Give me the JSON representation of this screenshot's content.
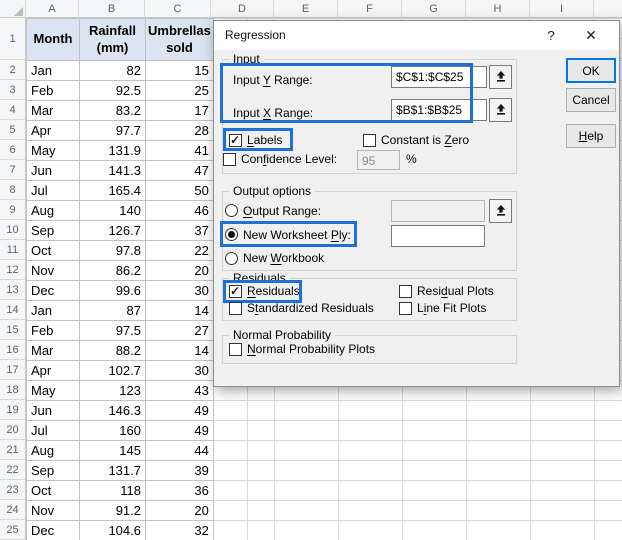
{
  "colors": {
    "annotation_blue": "#1e6fd8",
    "ok_focus_border": "#0078d7",
    "table_header_fill": "#dce3f1"
  },
  "sheet": {
    "col_headers": [
      "A",
      "B",
      "C",
      "D",
      "E",
      "F",
      "G",
      "H",
      "I"
    ],
    "header_row_num": "1",
    "table": {
      "headers": {
        "month": "Month",
        "rainfall": "Rainfall (mm)",
        "umbrellas": "Umbrellas sold"
      },
      "rows": [
        {
          "num": "2",
          "month": "Jan",
          "rain": "82",
          "sold": "15"
        },
        {
          "num": "3",
          "month": "Feb",
          "rain": "92.5",
          "sold": "25"
        },
        {
          "num": "4",
          "month": "Mar",
          "rain": "83.2",
          "sold": "17"
        },
        {
          "num": "5",
          "month": "Apr",
          "rain": "97.7",
          "sold": "28"
        },
        {
          "num": "6",
          "month": "May",
          "rain": "131.9",
          "sold": "41"
        },
        {
          "num": "7",
          "month": "Jun",
          "rain": "141.3",
          "sold": "47"
        },
        {
          "num": "8",
          "month": "Jul",
          "rain": "165.4",
          "sold": "50"
        },
        {
          "num": "9",
          "month": "Aug",
          "rain": "140",
          "sold": "46"
        },
        {
          "num": "10",
          "month": "Sep",
          "rain": "126.7",
          "sold": "37"
        },
        {
          "num": "11",
          "month": "Oct",
          "rain": "97.8",
          "sold": "22"
        },
        {
          "num": "12",
          "month": "Nov",
          "rain": "86.2",
          "sold": "20"
        },
        {
          "num": "13",
          "month": "Dec",
          "rain": "99.6",
          "sold": "30"
        },
        {
          "num": "14",
          "month": "Jan",
          "rain": "87",
          "sold": "14"
        },
        {
          "num": "15",
          "month": "Feb",
          "rain": "97.5",
          "sold": "27"
        },
        {
          "num": "16",
          "month": "Mar",
          "rain": "88.2",
          "sold": "14"
        },
        {
          "num": "17",
          "month": "Apr",
          "rain": "102.7",
          "sold": "30"
        },
        {
          "num": "18",
          "month": "May",
          "rain": "123",
          "sold": "43"
        },
        {
          "num": "19",
          "month": "Jun",
          "rain": "146.3",
          "sold": "49"
        },
        {
          "num": "20",
          "month": "Jul",
          "rain": "160",
          "sold": "49"
        },
        {
          "num": "21",
          "month": "Aug",
          "rain": "145",
          "sold": "44"
        },
        {
          "num": "22",
          "month": "Sep",
          "rain": "131.7",
          "sold": "39"
        },
        {
          "num": "23",
          "month": "Oct",
          "rain": "118",
          "sold": "36"
        },
        {
          "num": "24",
          "month": "Nov",
          "rain": "91.2",
          "sold": "20"
        },
        {
          "num": "25",
          "month": "Dec",
          "rain": "104.6",
          "sold": "32"
        }
      ]
    }
  },
  "dialog": {
    "title": "Regression",
    "titlebar": {
      "help_icon": "?",
      "close_icon": "✕"
    },
    "buttons": {
      "ok": "OK",
      "cancel": "Cancel",
      "help": {
        "pre": "",
        "key": "H",
        "post": "elp"
      }
    },
    "input_group": {
      "label": "Input",
      "y_range": {
        "label": {
          "pre": "Input ",
          "key": "Y",
          "post": " Range:"
        },
        "value": "$C$1:$C$25"
      },
      "x_range": {
        "label": {
          "pre": "Input ",
          "key": "X",
          "post": " Range:"
        },
        "value": "$B$1:$B$25"
      },
      "labels_cb": {
        "label": {
          "pre": "",
          "key": "L",
          "post": "abels"
        },
        "checked": true
      },
      "constant_cb": {
        "label": {
          "pre": "Constant is ",
          "key": "Z",
          "post": "ero"
        },
        "checked": false
      },
      "confidence_cb": {
        "label": {
          "pre": "Con",
          "key": "f",
          "post": "idence Level:"
        },
        "checked": false,
        "value": "95",
        "suffix": "%"
      }
    },
    "output_group": {
      "label": "Output options",
      "output_range": {
        "label": {
          "pre": "",
          "key": "O",
          "post": "utput Range:"
        },
        "selected": false,
        "value": ""
      },
      "new_worksheet": {
        "label": {
          "pre": "New Worksheet ",
          "key": "P",
          "post": "ly:"
        },
        "selected": true,
        "value": ""
      },
      "new_workbook": {
        "label": {
          "pre": "New ",
          "key": "W",
          "post": "orkbook"
        },
        "selected": false
      }
    },
    "residuals_group": {
      "label": "Residuals",
      "residuals_cb": {
        "label": {
          "pre": "",
          "key": "R",
          "post": "esiduals"
        },
        "checked": true
      },
      "standardized_cb": {
        "label": {
          "pre": "S",
          "key": "t",
          "post": "andardized Residuals"
        },
        "checked": false
      },
      "residual_plots_cb": {
        "label": {
          "pre": "Resi",
          "key": "d",
          "post": "ual Plots"
        },
        "checked": false
      },
      "line_fit_cb": {
        "label": {
          "pre": "L",
          "key": "i",
          "post": "ne Fit Plots"
        },
        "checked": false
      }
    },
    "normal_group": {
      "label": "Normal Probability",
      "normal_plots_cb": {
        "label": {
          "pre": "",
          "key": "N",
          "post": "ormal Probability Plots"
        },
        "checked": false
      }
    }
  }
}
